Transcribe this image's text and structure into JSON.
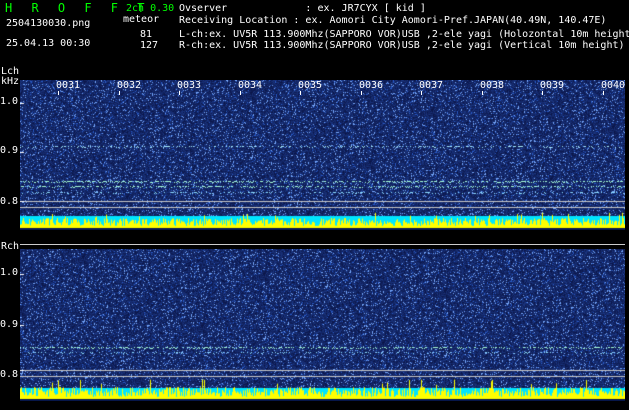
{
  "header": {
    "app_name": "H R O F F T",
    "filename": "2504130030.png",
    "datetime": "25.04.13 00:30",
    "channel_info": "2ch 0.30",
    "meteor_label": "meteor",
    "lch_count": "81",
    "rch_count": "127",
    "info_lines": [
      "Ovserver             : ex. JR7CYX [ kid ]",
      "Receiving Location : ex. Aomori City Aomori-Pref.JAPAN(40.49N, 140.47E)",
      "L-ch:ex. UV5R 113.900Mhz(SAPPORO VOR)USB ,2-ele yagi (Holozontal 10m height)",
      "R-ch:ex. UV5R 113.900Mhz(SAPPORO VOR)USB ,2-ele yagi (Vertical 10m height)"
    ]
  },
  "time_labels": [
    "0031",
    "0032",
    "0033",
    "0034",
    "0035",
    "0036",
    "0037",
    "0038",
    "0039",
    "0040"
  ],
  "left_panel": {
    "title": "Lch",
    "unit": "kHz",
    "y_ticks": [
      "1.0",
      "0.9",
      "0.8"
    ]
  },
  "right_panel": {
    "title": "Rch",
    "y_ticks": [
      "1.0",
      "0.9",
      "0.8"
    ]
  },
  "colors": {
    "bg": "#000000",
    "green": "#00ff00",
    "spectrum_bg": "#0a1f5c",
    "trace": "#9ff0ff",
    "baseline": "#00e5ff",
    "meteor": "#ffff00"
  }
}
